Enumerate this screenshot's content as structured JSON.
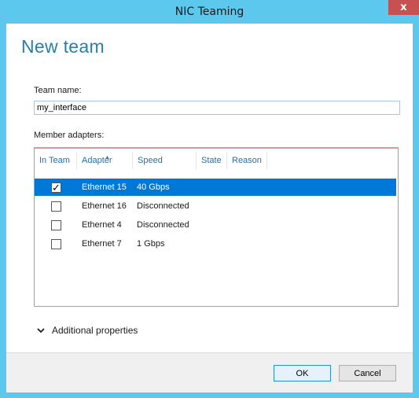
{
  "window": {
    "title": "NIC Teaming",
    "close": "x"
  },
  "page": {
    "heading": "New team"
  },
  "team_name": {
    "label": "Team name:",
    "value": "my_interface"
  },
  "members": {
    "label": "Member adapters:",
    "columns": [
      "In Team",
      "Adapter",
      "Speed",
      "State",
      "Reason"
    ],
    "rows": [
      {
        "in_team": true,
        "adapter": "Ethernet 15",
        "speed": "40 Gbps",
        "selected": true
      },
      {
        "in_team": false,
        "adapter": "Ethernet 16",
        "speed": "Disconnected",
        "selected": false
      },
      {
        "in_team": false,
        "adapter": "Ethernet 4",
        "speed": "Disconnected",
        "selected": false
      },
      {
        "in_team": false,
        "adapter": "Ethernet 7",
        "speed": "1 Gbps",
        "selected": false
      }
    ]
  },
  "additional": {
    "label": "Additional properties"
  },
  "buttons": {
    "ok": "OK",
    "cancel": "Cancel"
  },
  "colors": {
    "title_bar": "#5cc8ee",
    "heading": "#2a7fa5",
    "selection": "#0078d7"
  }
}
